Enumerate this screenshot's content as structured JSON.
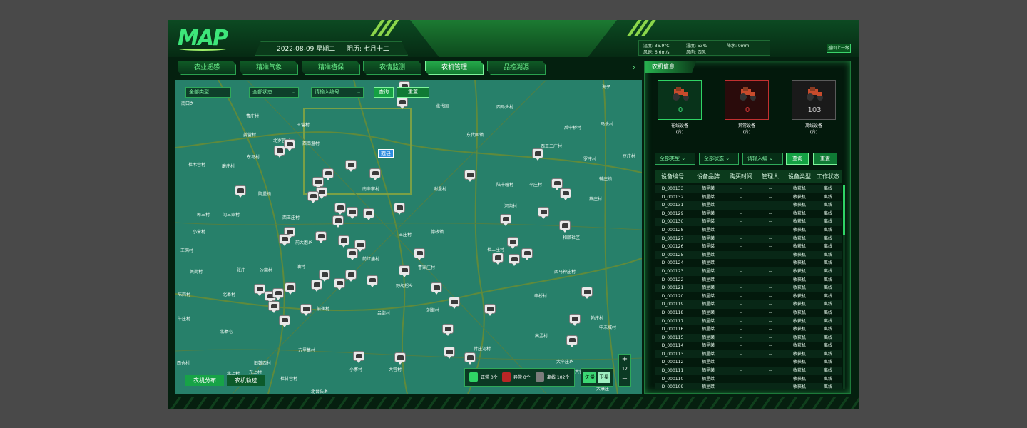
{
  "header": {
    "logo": "MAP",
    "date": "2022-08-09 星期二",
    "lunar": "阴历: 七月十二",
    "weather": {
      "temperature": "温度: 36.9°C",
      "humidity": "湿度: 53%",
      "rainfall": "降水: 0mm",
      "wind_speed": "风速: 6.6m/s",
      "wind_direction": "风向: 西风"
    },
    "back_button": "返回上一级"
  },
  "tabs": [
    {
      "label": "农业遥感",
      "active": false
    },
    {
      "label": "精准气象",
      "active": false
    },
    {
      "label": "精准植保",
      "active": false
    },
    {
      "label": "农情监测",
      "active": false
    },
    {
      "label": "农机管理",
      "active": true
    },
    {
      "label": "品控溯源",
      "active": false
    }
  ],
  "map": {
    "filters": {
      "type": "全部类型",
      "status": "全部状态",
      "input_placeholder": "请输入编号",
      "query": "查询",
      "reset": "重置"
    },
    "town_label": "魏县",
    "places": [
      "南口乡",
      "曹庄村",
      "王营村",
      "姜营村",
      "北罗营村",
      "西南温村",
      "东马村",
      "杜木营村",
      "廉庄村",
      "南辛寨村",
      "谢堡村",
      "陆十疃村",
      "辛庄村",
      "后申桥村",
      "西王二庄村",
      "海子",
      "马头村",
      "东代固镇",
      "北代固",
      "西马头村",
      "罗庄村",
      "豆庄村",
      "辅庄镇",
      "蔡庄村",
      "院堡镇",
      "郭三村",
      "闫三家村",
      "西王庄村",
      "小宋村",
      "前大磨乡",
      "王庄村",
      "德政镇",
      "河沟村",
      "和顺社区",
      "王岗村",
      "张庄",
      "沙窝村",
      "油村",
      "前红庙村",
      "杜二庄村",
      "关尚村",
      "曹家庄村",
      "西马神庙村",
      "陈岗村",
      "北皋村",
      "野胡拐乡",
      "前崔村",
      "吕街村",
      "刘街村",
      "申桥村",
      "勃庄村",
      "中未城村",
      "牛庄村",
      "北皋屯",
      "方里集村",
      "付庄河村",
      "高孟村",
      "大辛庄乡",
      "大营村",
      "旧魏西村",
      "杜甘营村",
      "小寨村",
      "北上村",
      "北台头乡",
      "东上村",
      "大营庄村",
      "西仓村",
      "大康庄"
    ],
    "bottom_tabs": [
      "农机分布",
      "农机轨迹"
    ],
    "legend": {
      "normal": "正常 0个",
      "abnormal": "异常 0个",
      "offline": "离线 102个"
    },
    "map_types": [
      "矢量",
      "卫星"
    ],
    "zoom_level": "12",
    "zoom_in": "+",
    "zoom_out": "−"
  },
  "panel": {
    "title": "农机信息",
    "stats": [
      {
        "label": "在线设备",
        "unit": "(台)",
        "value": "0",
        "color": "#3ee67a"
      },
      {
        "label": "异常设备",
        "unit": "(台)",
        "value": "0",
        "color": "#e83a3a"
      },
      {
        "label": "离线设备",
        "unit": "(台)",
        "value": "103",
        "color": "#cfcfcf"
      }
    ],
    "filters": {
      "type": "全部类型",
      "status": "全部状态",
      "input_placeholder": "请输入编",
      "query": "查询",
      "reset": "重置"
    },
    "columns": [
      "设备编号",
      "设备品牌",
      "购买时间",
      "管理人",
      "设备类型",
      "工作状态"
    ],
    "rows": [
      [
        "D_000133",
        "栖里桀",
        "--",
        "--",
        "收获机",
        "离线"
      ],
      [
        "D_000132",
        "栖里桀",
        "--",
        "--",
        "收获机",
        "离线"
      ],
      [
        "D_000131",
        "栖里桀",
        "--",
        "--",
        "收获机",
        "离线"
      ],
      [
        "D_000129",
        "栖里桀",
        "--",
        "--",
        "收获机",
        "离线"
      ],
      [
        "D_000130",
        "栖里桀",
        "--",
        "--",
        "收获机",
        "离线"
      ],
      [
        "D_000128",
        "栖里桀",
        "--",
        "--",
        "收获机",
        "离线"
      ],
      [
        "D_000127",
        "栖里桀",
        "--",
        "--",
        "收获机",
        "离线"
      ],
      [
        "D_000126",
        "栖里桀",
        "--",
        "--",
        "收获机",
        "离线"
      ],
      [
        "D_000125",
        "栖里桀",
        "--",
        "--",
        "收获机",
        "离线"
      ],
      [
        "D_000124",
        "栖里桀",
        "--",
        "--",
        "收获机",
        "离线"
      ],
      [
        "D_000123",
        "栖里桀",
        "--",
        "--",
        "收获机",
        "离线"
      ],
      [
        "D_000122",
        "栖里桀",
        "--",
        "--",
        "收获机",
        "离线"
      ],
      [
        "D_000121",
        "栖里桀",
        "--",
        "--",
        "收获机",
        "离线"
      ],
      [
        "D_000120",
        "栖里桀",
        "--",
        "--",
        "收获机",
        "离线"
      ],
      [
        "D_000119",
        "栖里桀",
        "--",
        "--",
        "收获机",
        "离线"
      ],
      [
        "D_000118",
        "栖里桀",
        "--",
        "--",
        "收获机",
        "离线"
      ],
      [
        "D_000117",
        "栖里桀",
        "--",
        "--",
        "收获机",
        "离线"
      ],
      [
        "D_000116",
        "栖里桀",
        "--",
        "--",
        "收获机",
        "离线"
      ],
      [
        "D_000115",
        "栖里桀",
        "--",
        "--",
        "收获机",
        "离线"
      ],
      [
        "D_000114",
        "栖里桀",
        "--",
        "--",
        "收获机",
        "离线"
      ],
      [
        "D_000113",
        "栖里桀",
        "--",
        "--",
        "收获机",
        "离线"
      ],
      [
        "D_000112",
        "栖里桀",
        "--",
        "--",
        "收获机",
        "离线"
      ],
      [
        "D_000111",
        "栖里桀",
        "--",
        "--",
        "收获机",
        "离线"
      ],
      [
        "D_000110",
        "栖里桀",
        "--",
        "--",
        "收获机",
        "离线"
      ],
      [
        "D_000109",
        "栖里桀",
        "--",
        "--",
        "收获机",
        "离线"
      ]
    ]
  }
}
